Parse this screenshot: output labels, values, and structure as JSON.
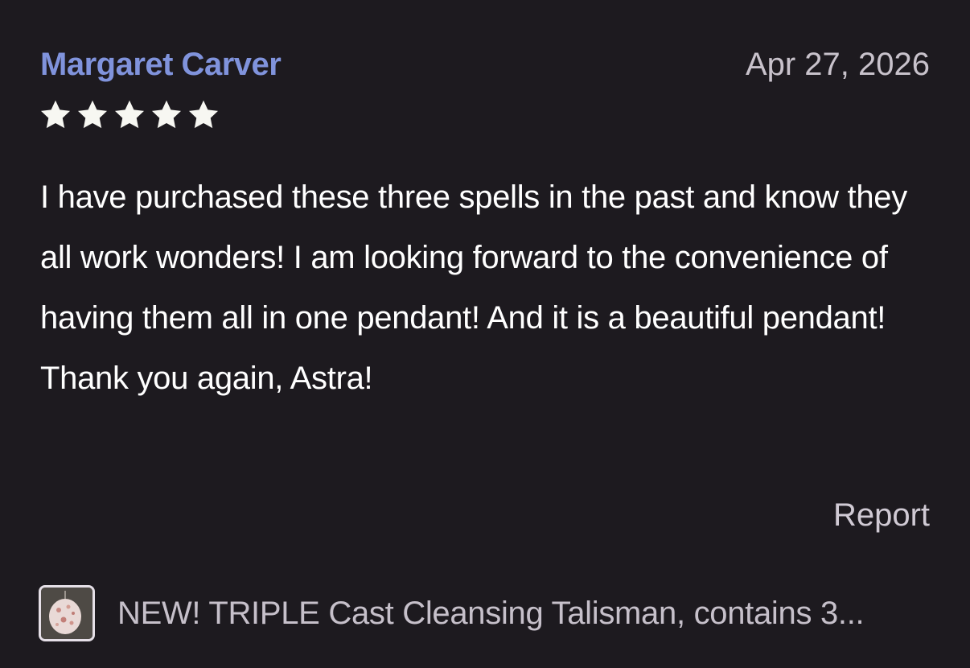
{
  "review": {
    "reviewer_name": "Margaret Carver",
    "date": "Apr 27, 2026",
    "rating": 5,
    "rating_max": 5,
    "star_color": "#f7f7f2",
    "body": "I have purchased these three spells in the past and know they all work wonders! I am looking forward to the convenience of having them all in one pendant! And it is a beautiful pendant! Thank you again, Astra!",
    "report_label": "Report"
  },
  "product": {
    "title": "NEW! TRIPLE Cast Cleansing Talisman, contains 3...",
    "thumbnail_icon": "pendant-thumbnail"
  },
  "colors": {
    "background": "#1d1a1f",
    "name_accent": "#8093dc",
    "muted_text": "#c8c2cb",
    "body_text": "#ffffff"
  }
}
